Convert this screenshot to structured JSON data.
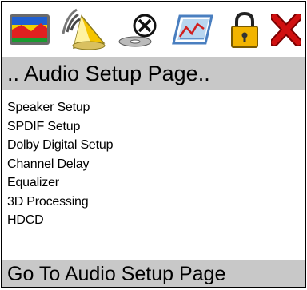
{
  "toolbar": {
    "icons": [
      {
        "name": "display-setup-icon",
        "selected": false
      },
      {
        "name": "audio-setup-icon",
        "selected": true
      },
      {
        "name": "disc-no-icon",
        "selected": false
      },
      {
        "name": "preferences-chart-icon",
        "selected": false
      },
      {
        "name": "lock-icon",
        "selected": false
      },
      {
        "name": "exit-icon",
        "selected": false
      }
    ]
  },
  "header": {
    "title": ".. Audio Setup Page.."
  },
  "menu": {
    "items": [
      "Speaker Setup",
      "SPDIF Setup",
      "Dolby Digital Setup",
      "Channel Delay",
      "Equalizer",
      "3D Processing",
      "HDCD"
    ]
  },
  "status": {
    "text": "Go To Audio Setup Page"
  },
  "colors": {
    "header_bg": "#c8c8c8",
    "status_bg": "#c8c8c8",
    "exit_red": "#d01010",
    "lock_yellow": "#f2b400"
  }
}
